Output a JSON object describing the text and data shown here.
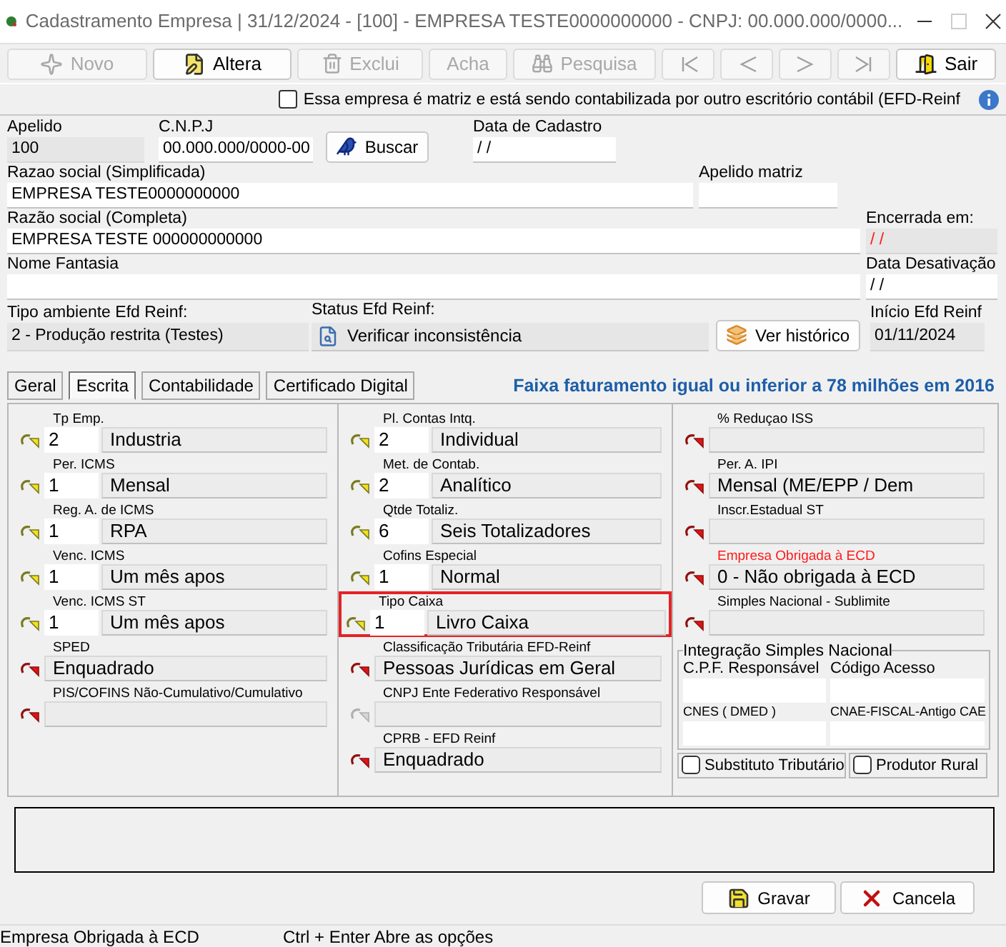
{
  "window": {
    "title": "Cadastramento Empresa |  31/12/2024 - [100] - EMPRESA TESTE0000000000 - CNPJ: 00.000.000/0000..."
  },
  "toolbar": [
    {
      "kind": "new",
      "label": "Novo",
      "disabled": true
    },
    {
      "kind": "edit",
      "label": "Altera",
      "disabled": false
    },
    {
      "kind": "delete",
      "label": "Exclui",
      "disabled": true
    },
    {
      "kind": "find",
      "label": "Acha",
      "disabled": true
    },
    {
      "kind": "search",
      "label": "Pesquisa",
      "disabled": true
    },
    {
      "kind": "first",
      "disabled": true
    },
    {
      "kind": "prev",
      "disabled": true
    },
    {
      "kind": "next",
      "disabled": true
    },
    {
      "kind": "last",
      "disabled": true
    },
    {
      "kind": "exit",
      "label": "Sair",
      "disabled": false
    }
  ],
  "matrix_option": {
    "label": "Essa empresa é matriz e está sendo contabilizada por outro escritório contábil (EFD-Reinf",
    "checked": false
  },
  "header": {
    "apelido": {
      "label": "Apelido",
      "value": "100"
    },
    "cnpj": {
      "label": "C.N.P.J",
      "value": "00.000.000/0000-00"
    },
    "buscar": "Buscar",
    "data_cadastro": {
      "label": "Data de Cadastro",
      "value": "/ /"
    },
    "razao_simplificada": {
      "label": "Razao social (Simplificada)",
      "value": "EMPRESA TESTE0000000000"
    },
    "apelido_matriz": {
      "label": "Apelido matriz"
    },
    "razao_completa": {
      "label": "Razão social (Completa)",
      "value": "EMPRESA TESTE 000000000000"
    },
    "encerrada": {
      "label": "Encerrada em:",
      "value": "/ /"
    },
    "nome_fantasia": {
      "label": "Nome Fantasia"
    },
    "data_desativacao": {
      "label": "Data Desativação",
      "value": "/ /"
    },
    "tipo_ambiente": {
      "label": "Tipo ambiente Efd Reinf:",
      "value": "2 - Produção restrita (Testes)"
    },
    "status": {
      "label": "Status Efd Reinf:",
      "value": "Verificar inconsistência"
    },
    "ver_historico": "Ver histórico",
    "inicio": {
      "label": "Início Efd Reinf",
      "value": "01/11/2024"
    }
  },
  "tabs": [
    {
      "label": "Geral",
      "selected": false
    },
    {
      "label": "Escrita",
      "selected": true
    },
    {
      "label": "Contabilidade",
      "selected": false
    },
    {
      "label": "Certificado Digital",
      "selected": false
    }
  ],
  "banner": "Faixa faturamento igual ou inferior a 78 milhões em 2016",
  "columns": [
    [
      {
        "label": "Tp Emp.",
        "kind": "lookup",
        "code": "2",
        "value": "Industria",
        "highlighted": false,
        "alert": false
      },
      {
        "label": "Per. ICMS",
        "kind": "lookup",
        "code": "1",
        "value": "Mensal",
        "highlighted": false,
        "alert": false
      },
      {
        "label": "Reg.  A. de ICMS",
        "kind": "lookup",
        "code": "1",
        "value": "RPA",
        "highlighted": false,
        "alert": false
      },
      {
        "label": "Venc. ICMS",
        "kind": "lookup",
        "code": "1",
        "value": "Um mês apos",
        "highlighted": false,
        "alert": false
      },
      {
        "label": "Venc. ICMS ST",
        "kind": "lookup",
        "code": "1",
        "value": "Um mês apos",
        "highlighted": false,
        "alert": false
      },
      {
        "label": "SPED",
        "kind": "required",
        "value": "Enquadrado",
        "highlighted": false,
        "alert": false
      },
      {
        "label": "PIS/COFINS Não-Cumulativo/Cumulativo",
        "kind": "required",
        "highlighted": false,
        "alert": false
      }
    ],
    [
      {
        "label": "Pl.  Contas Intq.",
        "kind": "lookup",
        "code": "2",
        "value": "Individual",
        "highlighted": false,
        "alert": false
      },
      {
        "label": "Met. de Contab.",
        "kind": "lookup",
        "code": "2",
        "value": "Analítico",
        "highlighted": false,
        "alert": false
      },
      {
        "label": "Qtde Totaliz.",
        "kind": "lookup",
        "code": "6",
        "value": "Seis Totalizadores",
        "highlighted": false,
        "alert": false
      },
      {
        "label": "Cofins Especial",
        "kind": "lookup",
        "code": "1",
        "value": "Normal",
        "highlighted": false,
        "alert": false
      },
      {
        "label": "Tipo Caixa",
        "kind": "lookup",
        "code": "1",
        "value": "Livro Caixa",
        "highlighted": true,
        "alert": false
      },
      {
        "label": "Classificação Tributária EFD-Reinf",
        "kind": "required",
        "value": "Pessoas Jurídicas em Geral",
        "highlighted": false,
        "alert": false
      },
      {
        "label": "CNPJ Ente Federativo Responsável",
        "kind": "inactive",
        "highlighted": false,
        "alert": false
      },
      {
        "label": "CPRB - EFD Reinf",
        "kind": "required",
        "value": "Enquadrado",
        "highlighted": false,
        "alert": false
      }
    ],
    [
      {
        "label": "% Reduçao ISS",
        "kind": "required",
        "highlighted": false,
        "alert": false
      },
      {
        "label": "Per. A.  IPI",
        "kind": "required",
        "value": "Mensal (ME/EPP / Dem",
        "highlighted": false,
        "alert": false
      },
      {
        "label": "Inscr.Estadual ST",
        "kind": "required",
        "highlighted": false,
        "alert": false
      },
      {
        "label": "Empresa Obrigada à ECD",
        "kind": "required",
        "value": "0 - Não obrigada à ECD",
        "highlighted": false,
        "alert": true
      },
      {
        "label": "Simples Nacional - Sublimite",
        "kind": "required",
        "highlighted": false,
        "alert": false
      }
    ]
  ],
  "integration": {
    "title": "Integração Simples Nacional",
    "fields": [
      {
        "label": "C.P.F. Responsável"
      },
      {
        "label": "Código Acesso"
      },
      {
        "label": "CNES ( DMED )"
      },
      {
        "label": "CNAE-FISCAL-Antigo CAE"
      }
    ]
  },
  "options": [
    {
      "label": "Substituto Tributário",
      "checked": false
    },
    {
      "label": "Produtor Rural",
      "checked": false
    }
  ],
  "actions": [
    {
      "kind": "save",
      "label": "Gravar"
    },
    {
      "kind": "cancel",
      "label": "Cancela"
    }
  ],
  "status_bar": [
    "Empresa Obrigada à ECD",
    "Ctrl + Enter Abre as opções"
  ]
}
